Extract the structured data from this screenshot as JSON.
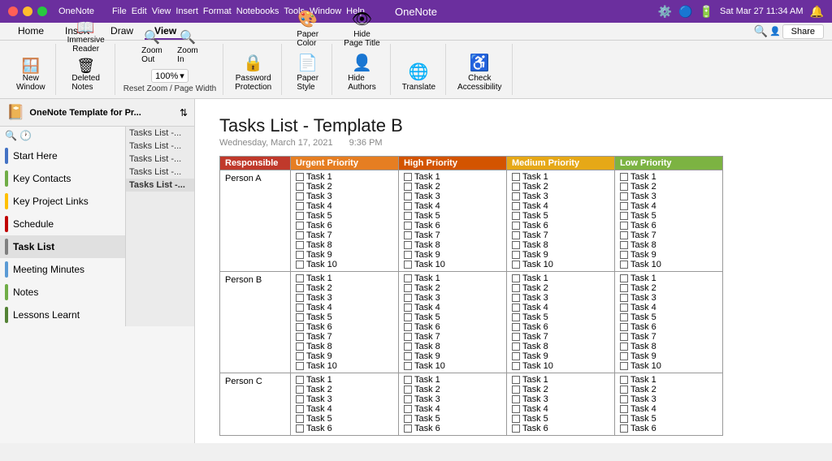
{
  "titlebar": {
    "app_name": "OneNote",
    "menu_items": [
      "OneNote",
      "File",
      "Edit",
      "View",
      "Insert",
      "Format",
      "Notebooks",
      "Tools",
      "Window",
      "Help"
    ],
    "datetime": "Sat Mar 27  11:34 AM",
    "center_title": "OneNote"
  },
  "ribbon": {
    "tabs": [
      "Home",
      "Insert",
      "Draw",
      "View"
    ],
    "active_tab": "View",
    "buttons": [
      {
        "label": "New\nWindow",
        "icon": "🪟"
      },
      {
        "label": "Immersive\nReader",
        "icon": "📖"
      },
      {
        "label": "Deleted\nNotes",
        "icon": "🗑"
      },
      {
        "label": "Zoom\nOut",
        "icon": "🔍"
      },
      {
        "label": "Zoom\nIn",
        "icon": "🔍"
      },
      {
        "label": "Reset Zoom\nPage Width",
        "icon": "🔲"
      },
      {
        "label": "Password\nProtection",
        "icon": "🔒"
      },
      {
        "label": "Paper\nColor",
        "icon": "🎨"
      },
      {
        "label": "Paper\nStyle",
        "icon": "📄"
      },
      {
        "label": "Hide\nPage Title",
        "icon": "👁"
      },
      {
        "label": "Hide\nAuthors",
        "icon": "👤"
      },
      {
        "label": "Translate",
        "icon": "🌐"
      },
      {
        "label": "Check\nAccessibility",
        "icon": "♿"
      }
    ],
    "zoom_value": "100%"
  },
  "sidebar": {
    "notebook_title": "OneNote Template for Pr...",
    "sections": [
      {
        "label": "Start Here",
        "color": "#4472c4",
        "pages": [
          "Tasks List -..."
        ]
      },
      {
        "label": "Key Contacts",
        "color": "#70ad47",
        "pages": [
          "Tasks List -..."
        ]
      },
      {
        "label": "Key Project Links",
        "color": "#ffc000",
        "pages": [
          "Tasks List -..."
        ]
      },
      {
        "label": "Schedule",
        "color": "#c00000",
        "pages": [
          "Tasks List -..."
        ]
      },
      {
        "label": "Task List",
        "color": "#808080",
        "pages": [
          "Tasks List -..."
        ],
        "active": true
      },
      {
        "label": "Meeting Minutes",
        "color": "#5b9bd5",
        "pages": []
      },
      {
        "label": "Notes",
        "color": "#70ad47",
        "pages": []
      },
      {
        "label": "Lessons Learnt",
        "color": "#548235",
        "pages": []
      }
    ]
  },
  "page": {
    "title": "Tasks List - Template B",
    "date": "Wednesday, March 17, 2021",
    "time": "9:36 PM",
    "table": {
      "headers": [
        "Responsible",
        "Urgent Priority",
        "High Priority",
        "Medium Priority",
        "Low Priority"
      ],
      "header_colors": [
        "#c0392b",
        "#e67e22",
        "#d35400",
        "#e6a817",
        "#7cb342"
      ],
      "persons": [
        {
          "name": "Person A",
          "tasks": [
            "Task 1",
            "Task 2",
            "Task 3",
            "Task 4",
            "Task 5",
            "Task 6",
            "Task 7",
            "Task 8",
            "Task 9",
            "Task 10"
          ]
        },
        {
          "name": "Person B",
          "tasks": [
            "Task 1",
            "Task 2",
            "Task 3",
            "Task 4",
            "Task 5",
            "Task 6",
            "Task 7",
            "Task 8",
            "Task 9",
            "Task 10"
          ]
        },
        {
          "name": "Person C",
          "tasks": [
            "Task 1",
            "Task 2",
            "Task 3",
            "Task 4",
            "Task 5",
            "Task 6"
          ]
        }
      ]
    }
  },
  "share_button": "Share"
}
